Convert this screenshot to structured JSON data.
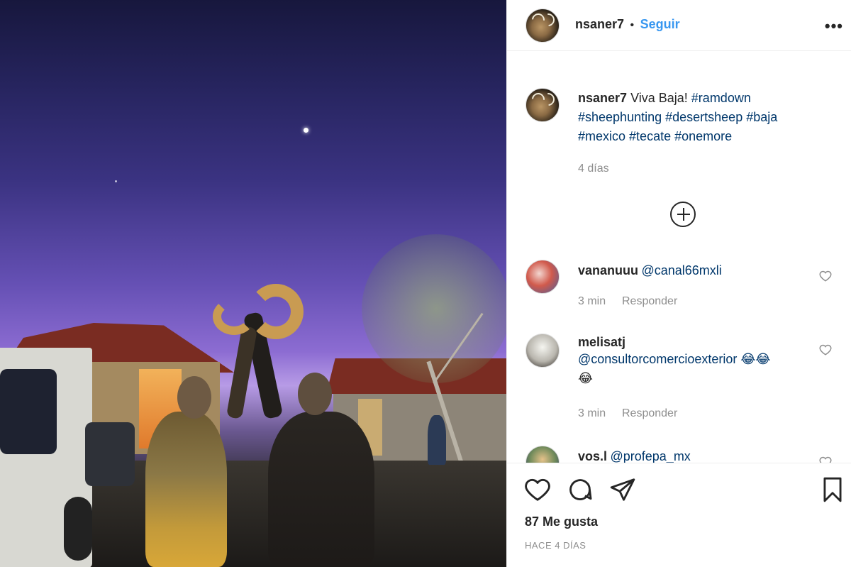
{
  "post": {
    "username": "nsaner7",
    "separator": "•",
    "follow_label": "Seguir",
    "more_label": "•••",
    "caption_text": "Viva Baja!",
    "hashtags_line1": "#ramdown",
    "hashtags_line2": [
      "#sheephunting",
      "#desertsheep",
      "#baja"
    ],
    "hashtags_line3": [
      "#mexico",
      "#tecate",
      "#onemore"
    ],
    "caption_time": "4 días",
    "likes": "87 Me gusta",
    "posted_ago": "HACE 4 DÍAS"
  },
  "comments": [
    {
      "username": "vananuuu",
      "text": "@canal66mxli",
      "time": "3 min",
      "reply_label": "Responder"
    },
    {
      "username": "melisatj",
      "text": "@consultorcomercioexterior 😂😂",
      "text_line2": "😂",
      "time": "3 min",
      "reply_label": "Responder"
    },
    {
      "username": "vos.l",
      "text": "@profepa_mx"
    }
  ],
  "icons": {
    "more": "more-options-icon",
    "load_more": "plus-circle-icon",
    "like": "heart-icon",
    "comment": "comment-bubble-icon",
    "share": "paper-plane-icon",
    "save": "bookmark-icon"
  },
  "colors": {
    "accent": "#3897f0",
    "hashtag": "#00376b",
    "muted": "#8e8e8e"
  }
}
